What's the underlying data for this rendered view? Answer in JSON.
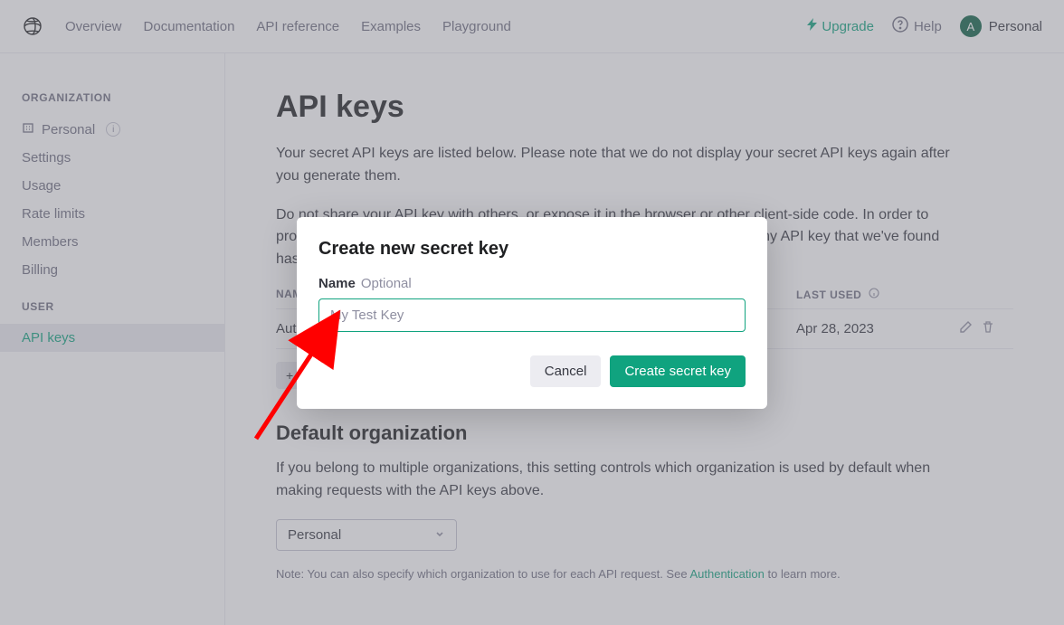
{
  "nav": {
    "links": [
      "Overview",
      "Documentation",
      "API reference",
      "Examples",
      "Playground"
    ],
    "upgrade": "Upgrade",
    "help": "Help",
    "avatar_initial": "A",
    "org_name": "Personal"
  },
  "sidebar": {
    "org_heading": "ORGANIZATION",
    "org_items": [
      "Personal",
      "Settings",
      "Usage",
      "Rate limits",
      "Members",
      "Billing"
    ],
    "user_heading": "USER",
    "user_items": [
      "API keys"
    ]
  },
  "main": {
    "page_title": "API keys",
    "intro_1": "Your secret API keys are listed below. Please note that we do not display your secret API keys again after you generate them.",
    "intro_2": "Do not share your API key with others, or expose it in the browser or other client-side code. In order to protect the security of your account, OpenAI may also automatically rotate any API key that we've found has leaked publicly.",
    "table": {
      "col_name": "NAME",
      "col_last": "LAST USED",
      "rows": [
        {
          "name": "Auto",
          "last_used": "Apr 28, 2023"
        }
      ]
    },
    "add_button": "+",
    "default_org_title": "Default organization",
    "default_org_text": "If you belong to multiple organizations, this setting controls which organization is used by default when making requests with the API keys above.",
    "default_org_value": "Personal",
    "note_prefix": "Note: You can also specify which organization to use for each API request. See ",
    "note_link": "Authentication",
    "note_suffix": " to learn more."
  },
  "modal": {
    "title": "Create new secret key",
    "name_label": "Name",
    "optional": "Optional",
    "placeholder": "My Test Key",
    "cancel": "Cancel",
    "create": "Create secret key"
  }
}
